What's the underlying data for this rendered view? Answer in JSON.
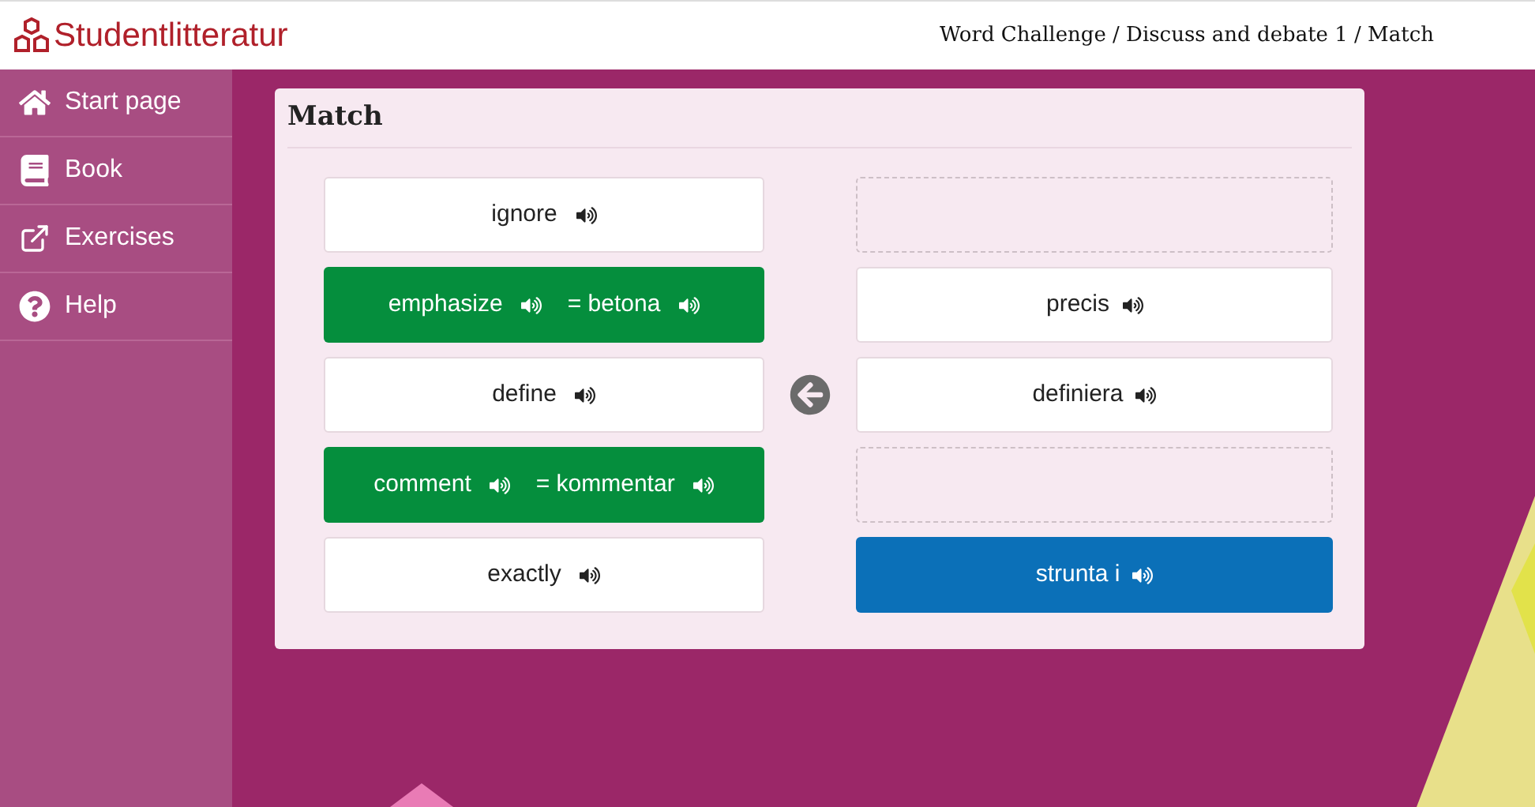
{
  "header": {
    "logo": "Studentlitteratur",
    "breadcrumb": "Word Challenge / Discuss and debate 1 / Match"
  },
  "sidebar": {
    "items": [
      {
        "label": "Start page"
      },
      {
        "label": "Book"
      },
      {
        "label": "Exercises"
      },
      {
        "label": "Help"
      }
    ]
  },
  "card": {
    "title": "Match",
    "left": [
      {
        "word": "ignore",
        "matched": false
      },
      {
        "word": "emphasize",
        "matched": true,
        "translation": "= betona"
      },
      {
        "word": "define",
        "matched": false
      },
      {
        "word": "comment",
        "matched": true,
        "translation": "= kommentar"
      },
      {
        "word": "exactly",
        "matched": false
      }
    ],
    "right": [
      {
        "kind": "empty"
      },
      {
        "kind": "word",
        "word": "precis",
        "selected": false
      },
      {
        "kind": "word",
        "word": "definiera",
        "selected": false
      },
      {
        "kind": "empty"
      },
      {
        "kind": "word",
        "word": "strunta i",
        "selected": true
      }
    ]
  }
}
